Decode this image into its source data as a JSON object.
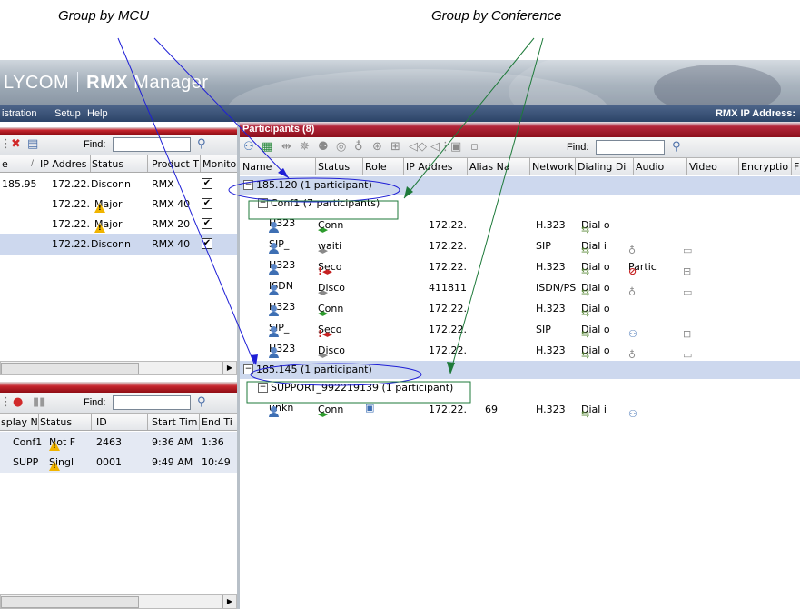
{
  "captions": {
    "mcu": "Group by MCU",
    "conference": "Group by Conference"
  },
  "app": {
    "logo_left": "LYCOM",
    "logo_bold": "RMX",
    "logo_right": "Manager"
  },
  "menu": {
    "items": [
      "istration",
      "Setup",
      "Help"
    ],
    "rmx_ip": "RMX IP Address:"
  },
  "mcu_list": {
    "find_label": "Find:",
    "columns": [
      "e",
      "IP Addres",
      "Status",
      "Product T",
      "Monito"
    ],
    "rows": [
      {
        "name": "185.95",
        "ip": "172.22.",
        "status": "Disconn",
        "warn": false,
        "product": "RMX",
        "monitor": true
      },
      {
        "name": "",
        "ip": "172.22.",
        "status": "Major",
        "warn": true,
        "product": "RMX 40",
        "monitor": true
      },
      {
        "name": "",
        "ip": "172.22.",
        "status": "Major",
        "warn": true,
        "product": "RMX 20",
        "monitor": true
      },
      {
        "name": "",
        "ip": "172.22.",
        "status": "Disconn",
        "warn": false,
        "product": "RMX 40",
        "monitor": true
      }
    ]
  },
  "conf_list": {
    "find_label": "Find:",
    "columns": [
      "splay N",
      "Status",
      "ID",
      "Start Tim",
      "End Ti"
    ],
    "rows": [
      {
        "name": "Conf1",
        "status": "Not F",
        "id": "2463",
        "start": "9:36 AM",
        "end": "1:36"
      },
      {
        "name": "SUPP",
        "status": "Singl",
        "id": "0001",
        "start": "9:49 AM",
        "end": "10:49"
      }
    ]
  },
  "participants": {
    "title": "Participants (8)",
    "find_label": "Find:",
    "columns": [
      "Name",
      "Status",
      "Role",
      "IP Addres",
      "Alias Na",
      "Network",
      "Dialing Di",
      "Audio",
      "Video",
      "Encryptio",
      "F"
    ],
    "groups": [
      {
        "mcu": "185.120 (1  participant)",
        "conference": "Conf1 (7  participants)",
        "rows": [
          {
            "name": "H323",
            "status": "Conn",
            "state": "ok",
            "role": "",
            "ip": "172.22.",
            "alias": "",
            "network": "H.323",
            "dial": "Dial o",
            "audio": "",
            "video": ""
          },
          {
            "name": "SIP_",
            "status": "waiti",
            "state": "dim",
            "role": "",
            "ip": "172.22.",
            "alias": "",
            "network": "SIP",
            "dial": "Dial i",
            "audio": "mic",
            "video": "cam"
          },
          {
            "name": "H323",
            "status": "Seco",
            "state": "bad",
            "role": "",
            "ip": "172.22.",
            "alias": "",
            "network": "H.323",
            "dial": "Dial o",
            "audio": "Partic",
            "video": "cam2"
          },
          {
            "name": "ISDN",
            "status": "Disco",
            "state": "dim",
            "role": "",
            "ip": "411811",
            "alias": "",
            "network": "ISDN/PS",
            "dial": "Dial o",
            "audio": "mic",
            "video": "cam"
          },
          {
            "name": "H323",
            "status": "Conn",
            "state": "ok",
            "role": "",
            "ip": "172.22.",
            "alias": "",
            "network": "H.323",
            "dial": "Dial o",
            "audio": "",
            "video": ""
          },
          {
            "name": "SIP_",
            "status": "Seco",
            "state": "bad",
            "role": "",
            "ip": "172.22.",
            "alias": "",
            "network": "SIP",
            "dial": "Dial o",
            "audio": "people",
            "video": "cam2"
          },
          {
            "name": "H323",
            "status": "Disco",
            "state": "dim",
            "role": "",
            "ip": "172.22.",
            "alias": "",
            "network": "H.323",
            "dial": "Dial o",
            "audio": "mic",
            "video": "cam"
          }
        ]
      },
      {
        "mcu": "185.145 (1  participant)",
        "conference": "SUPPORT_992219139 (1  participant)",
        "rows": [
          {
            "name": "unkn",
            "status": "Conn",
            "state": "ok",
            "role": "role",
            "ip": "172.22.",
            "alias": "69",
            "network": "H.323",
            "dial": "Dial i",
            "audio": "people",
            "video": ""
          }
        ]
      }
    ]
  },
  "colors": {
    "callout_blue": "#1f1fd6",
    "callout_green": "#1e7a3a",
    "selected_row": "#cdd8ee"
  }
}
